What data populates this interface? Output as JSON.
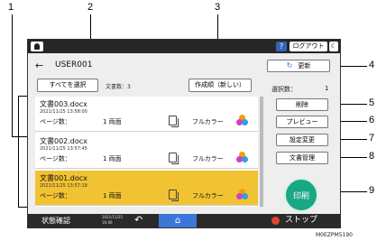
{
  "callouts": [
    "1",
    "2",
    "3",
    "4",
    "5",
    "6",
    "7",
    "8",
    "9"
  ],
  "topbar": {
    "help": "?",
    "logout": "ログアウト",
    "moon": "☾"
  },
  "header": {
    "back_icon": "←",
    "user": "USER001",
    "refresh": "更新",
    "refresh_icon": "↻"
  },
  "toolbar": {
    "select_all": "すべてを選択",
    "doc_count": "文書数：3",
    "sort": "作成順（新しい）"
  },
  "documents": [
    {
      "name": "文書003.docx",
      "date": "2021/11/25 13:58:00",
      "pages_label": "ページ数：",
      "pages": "1 両面",
      "color_mode": "フルカラー",
      "selected": false
    },
    {
      "name": "文書002.docx",
      "date": "2021/11/25 13:57:45",
      "pages_label": "ページ数：",
      "pages": "1 両面",
      "color_mode": "フルカラー",
      "selected": false
    },
    {
      "name": "文書001.docx",
      "date": "2021/11/25 13:57:19",
      "pages_label": "ページ数：",
      "pages": "1 両面",
      "color_mode": "フルカラー",
      "selected": true
    }
  ],
  "side": {
    "sel_label": "選択数：",
    "sel_value": "1",
    "delete": "削除",
    "preview": "プレビュー",
    "settings": "設定変更",
    "manage": "文書管理",
    "print": "印刷"
  },
  "statusbar": {
    "status": "状態確認",
    "time_date": "2021/11/25",
    "time_clock": "16:06",
    "undo": "↶",
    "home": "⌂",
    "stop": "ストップ"
  },
  "code": "M0EZPM5190",
  "colors": {
    "selected_row": "#f1c232",
    "print_button": "#1aa784",
    "home_button": "#3a77d9"
  }
}
